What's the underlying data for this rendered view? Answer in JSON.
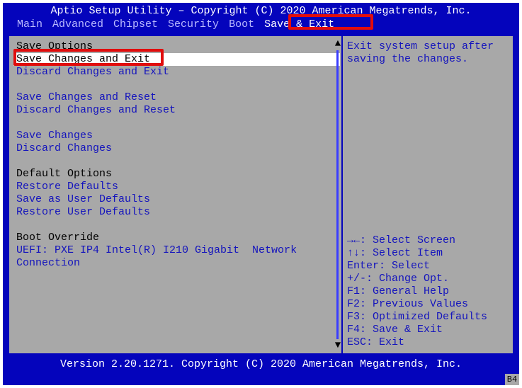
{
  "title": "Aptio Setup Utility – Copyright (C) 2020 American Megatrends, Inc.",
  "tabs": {
    "items": [
      "Main",
      "Advanced",
      "Chipset",
      "Security",
      "Boot",
      "Save & Exit"
    ],
    "active_index": 5
  },
  "left": {
    "lines": [
      {
        "text": "Save Options",
        "type": "header"
      },
      {
        "text": "Save Changes and Exit",
        "type": "item",
        "selected": true
      },
      {
        "text": "Discard Changes and Exit",
        "type": "item"
      },
      {
        "text": "",
        "type": "spacer"
      },
      {
        "text": "Save Changes and Reset",
        "type": "item"
      },
      {
        "text": "Discard Changes and Reset",
        "type": "item"
      },
      {
        "text": "",
        "type": "spacer"
      },
      {
        "text": "Save Changes",
        "type": "item"
      },
      {
        "text": "Discard Changes",
        "type": "item"
      },
      {
        "text": "",
        "type": "spacer"
      },
      {
        "text": "Default Options",
        "type": "header"
      },
      {
        "text": "Restore Defaults",
        "type": "item"
      },
      {
        "text": "Save as User Defaults",
        "type": "item"
      },
      {
        "text": "Restore User Defaults",
        "type": "item"
      },
      {
        "text": "",
        "type": "spacer"
      },
      {
        "text": "Boot Override",
        "type": "header"
      },
      {
        "text": "UEFI: PXE IP4 Intel(R) I210 Gigabit  Network",
        "type": "item"
      },
      {
        "text": "Connection",
        "type": "item"
      }
    ]
  },
  "right": {
    "help": "Exit system setup after saving the changes.",
    "keys": [
      "→←: Select Screen",
      "↑↓: Select Item",
      "Enter: Select",
      "+/-: Change Opt.",
      "F1: General Help",
      "F2: Previous Values",
      "F3: Optimized Defaults",
      "F4: Save & Exit",
      "ESC: Exit"
    ]
  },
  "footer": "Version 2.20.1271. Copyright (C) 2020 American Megatrends, Inc.",
  "badge": "B4"
}
